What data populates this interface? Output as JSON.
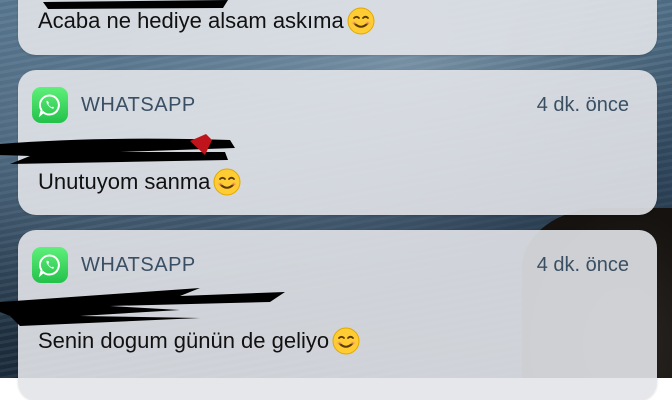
{
  "background": {
    "description_color": "#2c4257"
  },
  "notifications": [
    {
      "app_name": "",
      "time": "",
      "message": "Acaba ne hediye alsam askıma",
      "emoji": "smiling-face-icon"
    },
    {
      "app_name": "WHATSAPP",
      "time": "4 dk. önce",
      "message": "Unutuyom sanma",
      "emoji": "smiling-face-icon"
    },
    {
      "app_name": "WHATSAPP",
      "time": "4 dk. önce",
      "message": "Senin dogum günün de geliyo",
      "emoji": "smiling-face-icon"
    }
  ],
  "colors": {
    "whatsapp_green": "#25d366",
    "header_text": "#3a4f63",
    "card_bg": "#e2e4e9",
    "redaction": "#000000"
  }
}
